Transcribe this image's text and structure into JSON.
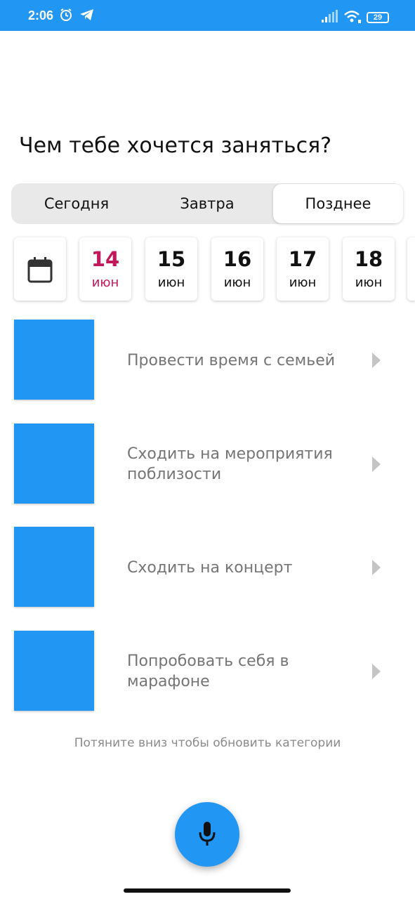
{
  "status_bar": {
    "time": "2:06",
    "battery": "29",
    "color": "#2196F3",
    "icons": [
      "alarm-icon",
      "telegram-icon",
      "signal-icon",
      "wifi-icon",
      "battery-icon"
    ]
  },
  "header": {
    "title": "Чем тебе хочется заняться?"
  },
  "day_tabs": {
    "items": [
      {
        "label": "Сегодня"
      },
      {
        "label": "Завтра"
      },
      {
        "label": "Позднее"
      }
    ],
    "selected": "Позднее"
  },
  "dates": {
    "calendar_icon": "calendar-icon",
    "items": [
      {
        "day": "14",
        "month": "июн"
      },
      {
        "day": "15",
        "month": "июн"
      },
      {
        "day": "16",
        "month": "июн"
      },
      {
        "day": "17",
        "month": "июн"
      },
      {
        "day": "18",
        "month": "июн"
      }
    ],
    "selected_day": "14",
    "selected_color": "#C2185B"
  },
  "categories": {
    "items": [
      {
        "label": "Провести время с семьей"
      },
      {
        "label": "Сходить на мероприятия поблизости"
      },
      {
        "label": "Сходить на концерт"
      },
      {
        "label": "Попробовать себя в марафоне"
      }
    ],
    "thumbnail_color": "#2196F3"
  },
  "footer": {
    "hint": "Потяните вниз чтобы обновить категории",
    "fab_icon": "microphone-icon"
  }
}
